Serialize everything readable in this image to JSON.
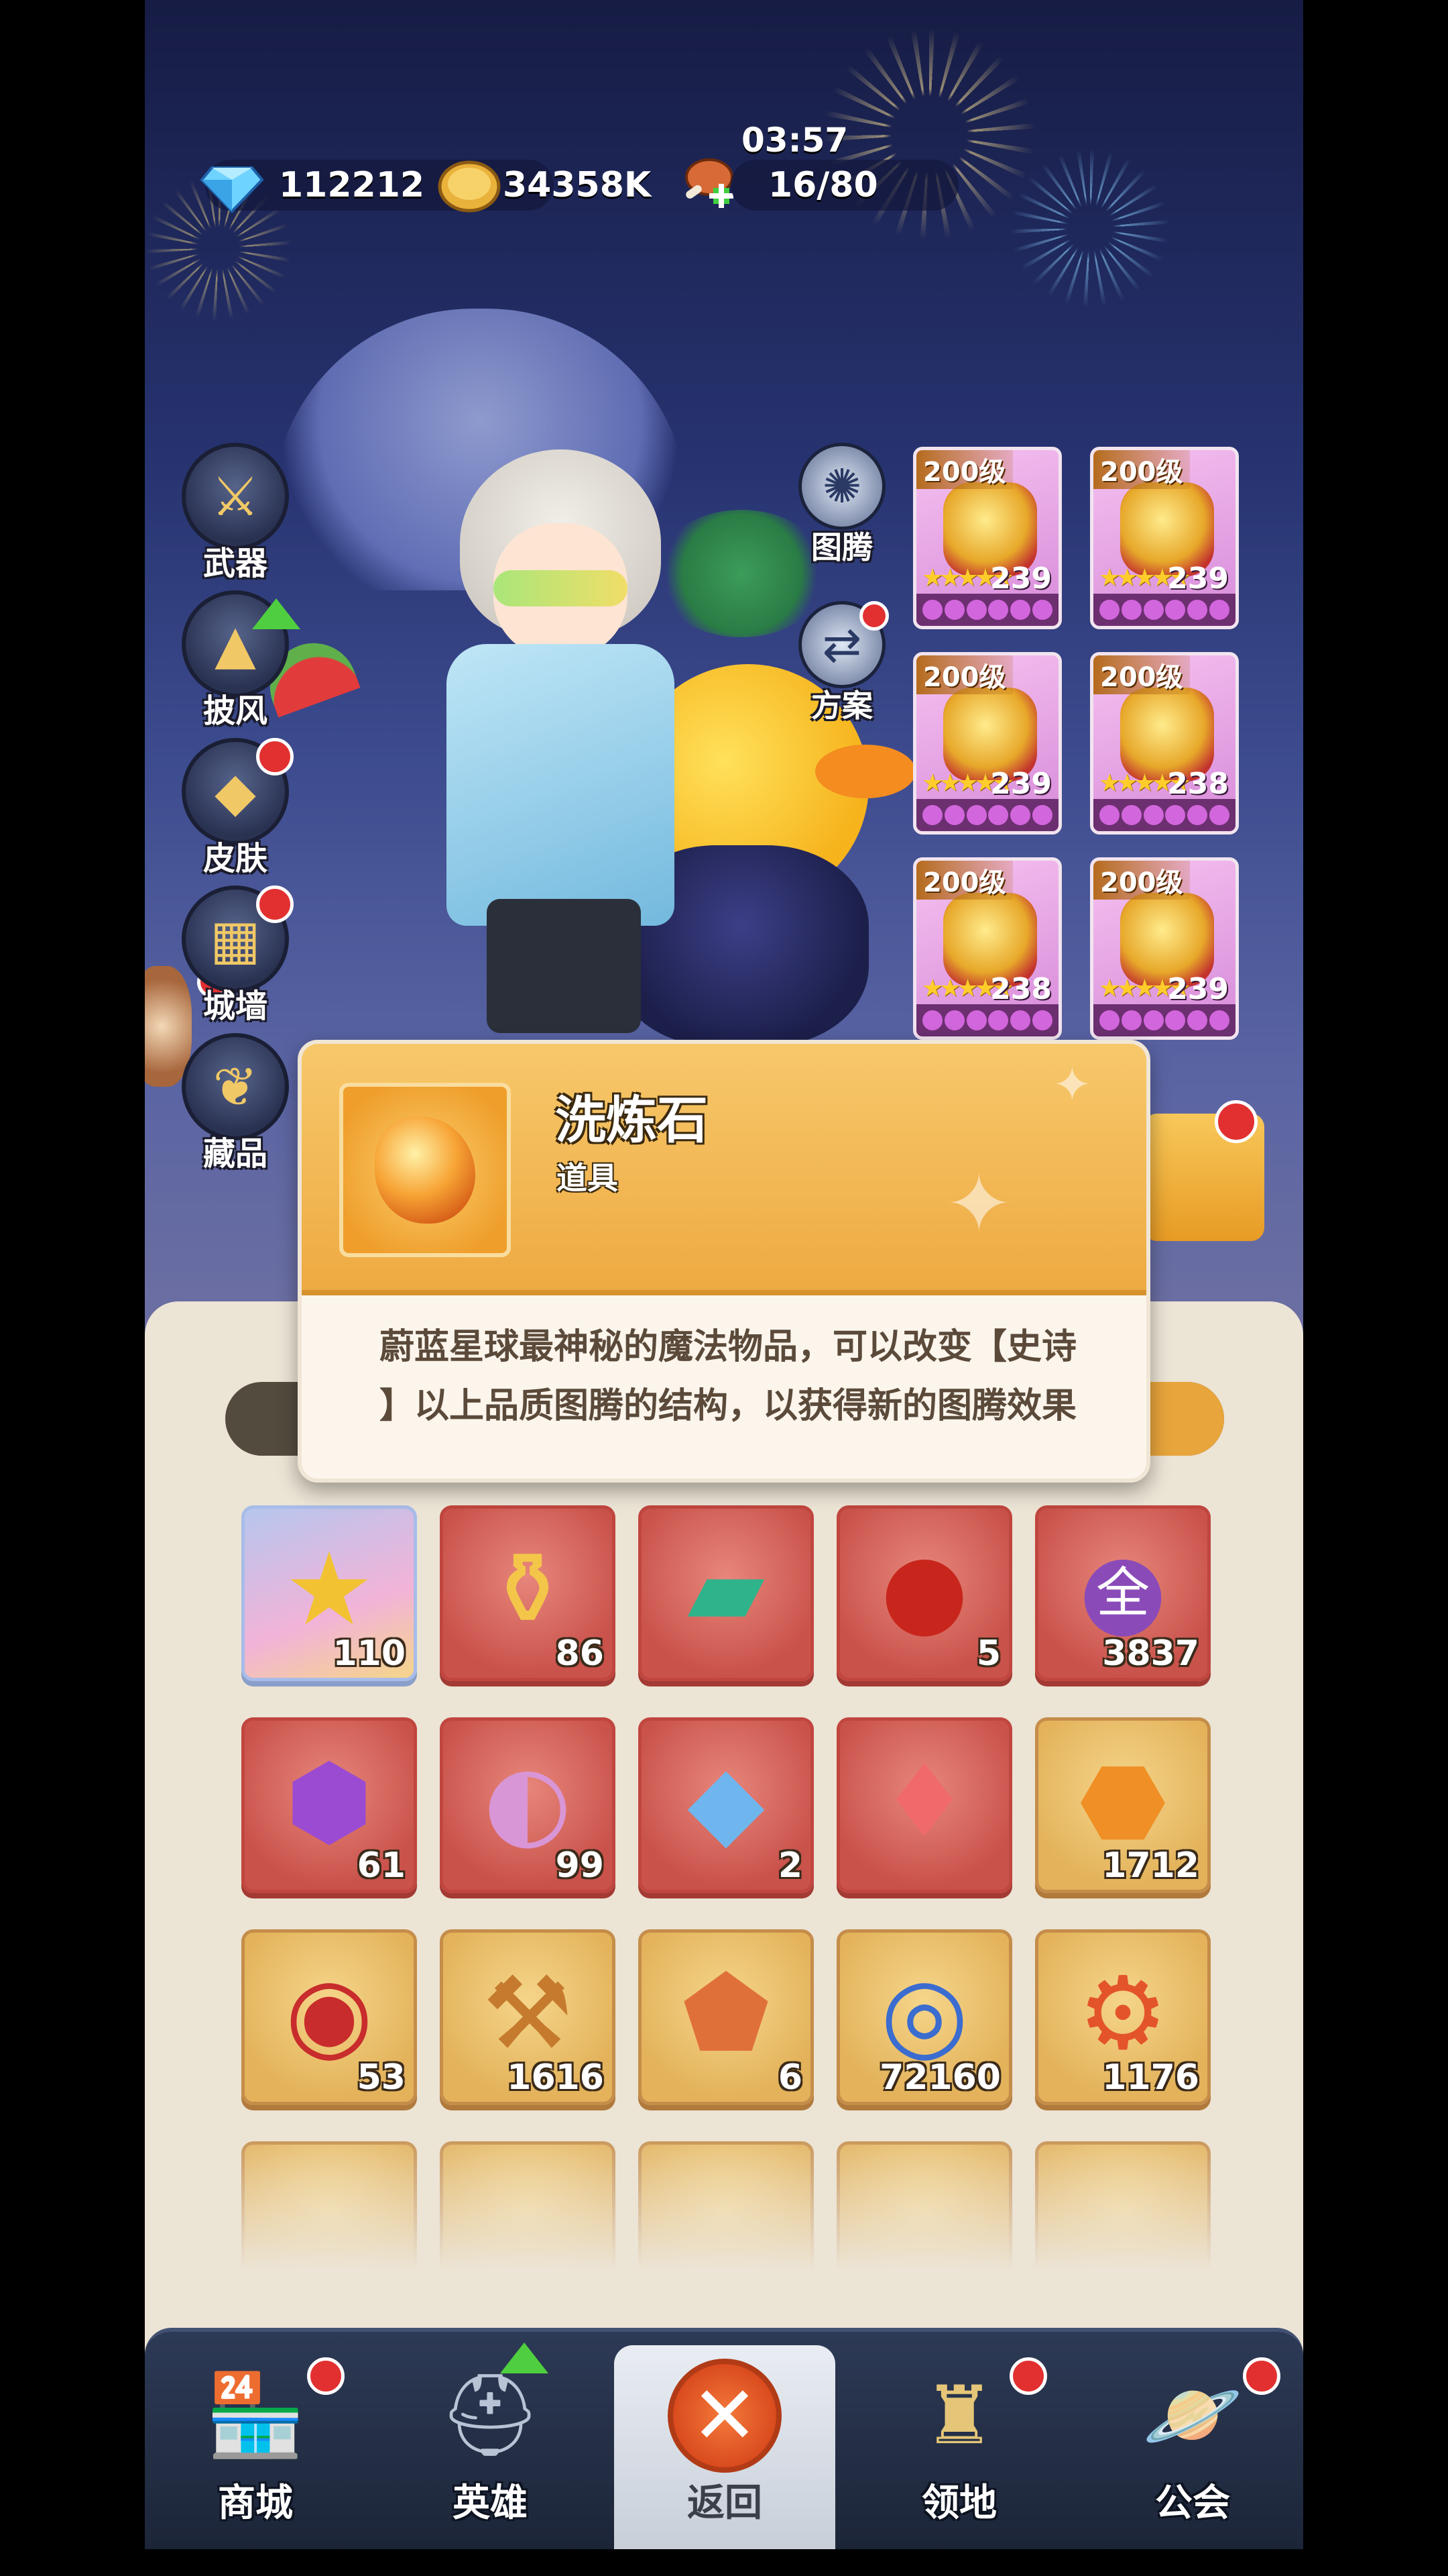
{
  "resources": {
    "gems": "112212",
    "gold": "34358K",
    "stamina": "16/80",
    "timer": "03:57"
  },
  "side_menu": [
    {
      "label": "武器",
      "icon": "sword-shield-icon"
    },
    {
      "label": "披风",
      "icon": "cape-icon",
      "badge": "upgrade"
    },
    {
      "label": "皮肤",
      "icon": "armor-icon",
      "badge": "red-dot"
    },
    {
      "label": "城墙",
      "icon": "wall-icon",
      "badge": "red-dot"
    },
    {
      "label": "藏品",
      "icon": "collection-icon"
    }
  ],
  "mid_menu": [
    {
      "label": "图腾",
      "icon": "totem-icon"
    },
    {
      "label": "方案",
      "icon": "scheme-icon",
      "badge": "red-dot"
    }
  ],
  "equipment": [
    {
      "level": "200级",
      "score": "239"
    },
    {
      "level": "200级",
      "score": "239"
    },
    {
      "level": "200级",
      "score": "239"
    },
    {
      "level": "200级",
      "score": "238"
    },
    {
      "level": "200级",
      "score": "238"
    },
    {
      "level": "200级",
      "score": "239"
    }
  ],
  "tooltip": {
    "name": "洗炼石",
    "type": "道具",
    "description": "蔚蓝星球最神秘的魔法物品，可以改变【史诗】以上品质图腾的结构，以获得新的图腾效果",
    "line1": "蔚蓝星球最神秘的魔法物品，可以改变【史诗",
    "line2": "】以上品质图腾的结构，以获得新的图腾效果"
  },
  "inventory": [
    {
      "count": "110",
      "icon": "star-icon",
      "style": "star"
    },
    {
      "count": "86",
      "icon": "magic-lamp-icon",
      "style": "red"
    },
    {
      "count": "",
      "icon": "ticket-icon",
      "style": "red"
    },
    {
      "count": "5",
      "icon": "red-fruit-icon",
      "style": "red"
    },
    {
      "count": "3837",
      "icon": "purple-drop-icon",
      "style": "red",
      "glyph": "全"
    },
    {
      "count": "61",
      "icon": "purple-gem-icon",
      "style": "red"
    },
    {
      "count": "99",
      "icon": "conch-icon",
      "style": "red"
    },
    {
      "count": "2",
      "icon": "crystal-icon",
      "style": "red"
    },
    {
      "count": "",
      "icon": "winged-gem-icon",
      "style": "red"
    },
    {
      "count": "1712",
      "icon": "refine-stone-icon",
      "style": "gold"
    },
    {
      "count": "53",
      "icon": "chip-icon",
      "style": "gold"
    },
    {
      "count": "1616",
      "icon": "hammer-icon",
      "style": "gold"
    },
    {
      "count": "6",
      "icon": "ore-icon",
      "style": "gold"
    },
    {
      "count": "72160",
      "icon": "pet-coin-icon",
      "style": "gold"
    },
    {
      "count": "1176",
      "icon": "gear-orb-icon",
      "style": "gold"
    },
    {
      "count": "",
      "icon": "faded-item-icon",
      "style": "gold"
    },
    {
      "count": "",
      "icon": "faded-item-icon",
      "style": "gold"
    },
    {
      "count": "",
      "icon": "faded-item-icon",
      "style": "gold"
    },
    {
      "count": "",
      "icon": "faded-item-icon",
      "style": "gold"
    },
    {
      "count": "",
      "icon": "faded-item-icon",
      "style": "gold"
    }
  ],
  "bottom_nav": [
    {
      "label": "商城",
      "icon": "shop-icon",
      "badge": "red-dot"
    },
    {
      "label": "英雄",
      "icon": "helmet-icon",
      "badge": "upgrade"
    },
    {
      "label": "返回",
      "icon": "close-icon",
      "active": true
    },
    {
      "label": "领地",
      "icon": "castle-icon",
      "badge": "red-dot"
    },
    {
      "label": "公会",
      "icon": "planet-icon",
      "badge": "red-dot"
    }
  ]
}
